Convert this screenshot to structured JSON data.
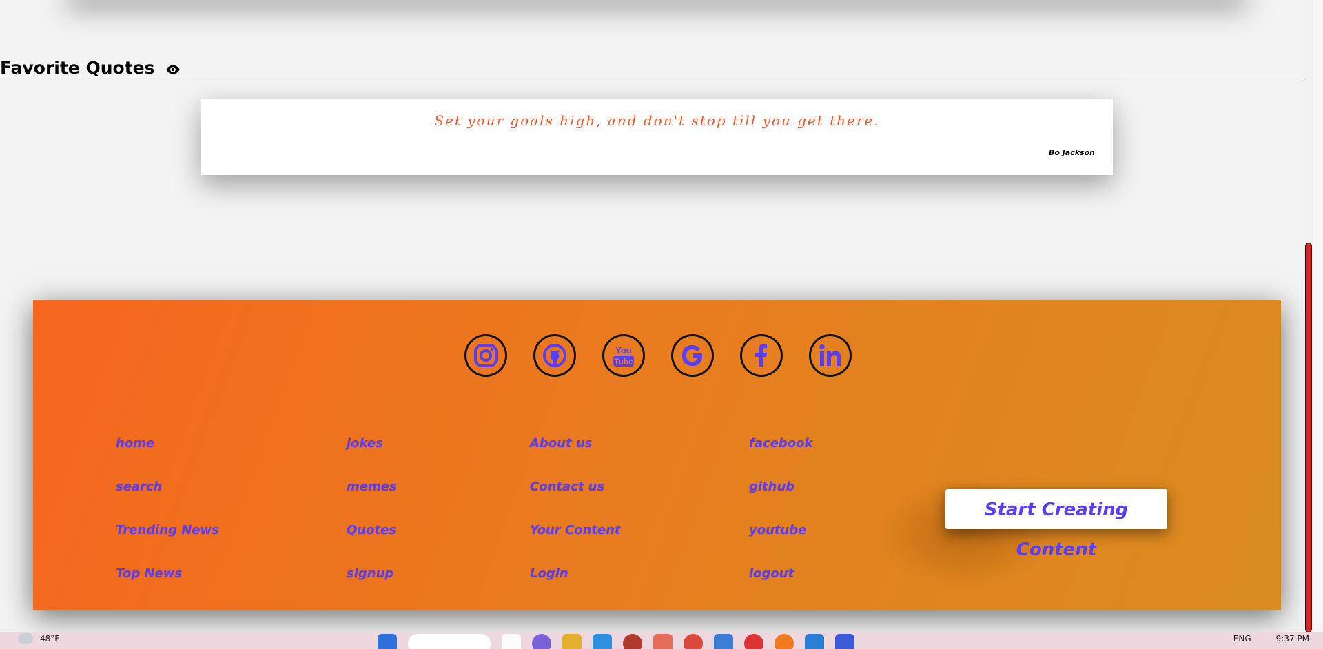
{
  "section": {
    "title": "Favorite Quotes",
    "visibility_icon": "eye-icon"
  },
  "quote": {
    "text": "Set your goals high, and don't stop till you get there.",
    "author": "Bo Jackson"
  },
  "footer": {
    "social": [
      {
        "name": "instagram",
        "icon": "instagram-icon"
      },
      {
        "name": "github",
        "icon": "github-icon"
      },
      {
        "name": "youtube",
        "icon": "youtube-icon"
      },
      {
        "name": "google",
        "icon": "google-icon"
      },
      {
        "name": "facebook",
        "icon": "facebook-icon"
      },
      {
        "name": "linkedin",
        "icon": "linkedin-icon"
      }
    ],
    "columns": [
      [
        "home",
        "search",
        "Trending News",
        "Top News"
      ],
      [
        "jokes",
        "memes",
        "Quotes",
        "signup"
      ],
      [
        "About us",
        "Contact us",
        "Your Content",
        "Login"
      ],
      [
        "facebook",
        "github",
        "youtube",
        "logout"
      ]
    ],
    "cta_label": "Start Creating Content",
    "colors": {
      "gradient_start": "#f6661e",
      "gradient_end": "#d98c20",
      "link": "#5b3df2",
      "quote": "#f2562a"
    }
  },
  "taskbar": {
    "weather": "48°F",
    "language": "ENG",
    "time": "9:37 PM"
  }
}
